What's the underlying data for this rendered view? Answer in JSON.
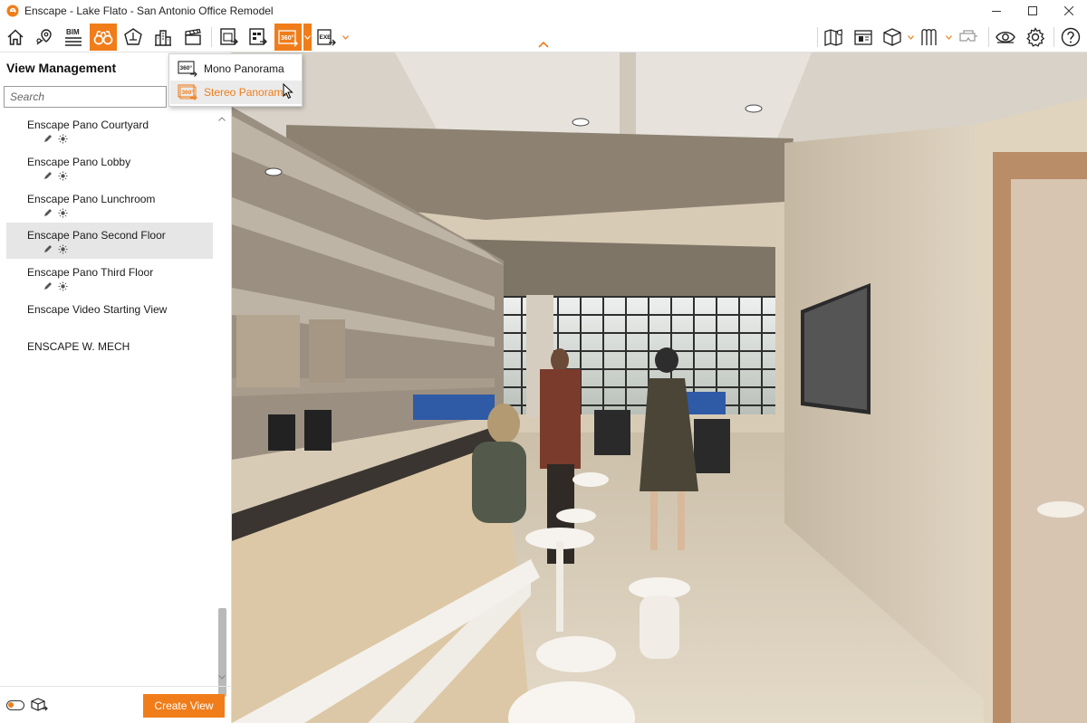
{
  "window": {
    "title": "Enscape - Lake Flato - San Antonio Office Remodel",
    "accent_color": "#f07d1a",
    "controls": [
      "minimize-icon",
      "maximize-icon",
      "close-icon"
    ]
  },
  "toolbar": {
    "left_buttons": [
      "home-icon",
      "location-pin-icon",
      "bim-icon",
      "binoculars-icon",
      "atmosphere-icon",
      "asset-library-icon",
      "video-editor-icon",
      "screenshot-icon",
      "batch-render-icon",
      "panorama-icon",
      "export-icon"
    ],
    "active_buttons": [
      "binoculars-icon",
      "panorama-icon"
    ],
    "bim_label": "BIM",
    "pano_label": "360°",
    "export_label": "EXE",
    "right_buttons": [
      "map-icon",
      "clipboard-icon",
      "cube-icon",
      "material-icon",
      "vr-headset-icon",
      "eye-icon",
      "settings-icon",
      "help-icon"
    ]
  },
  "panorama_menu": {
    "items": [
      {
        "label": "Mono Panorama",
        "icon": "mono-panorama-icon",
        "badge": "360°"
      },
      {
        "label": "Stereo Panorama",
        "icon": "stereo-panorama-icon",
        "badge": "360°"
      }
    ],
    "hovered_index": 1
  },
  "view_management": {
    "title": "View Management",
    "search_placeholder": "Search",
    "views": [
      {
        "label": "Enscape Pano Courtyard",
        "has_icons": true
      },
      {
        "label": "Enscape Pano Lobby",
        "has_icons": true
      },
      {
        "label": "Enscape Pano Lunchroom",
        "has_icons": true
      },
      {
        "label": "Enscape Pano Second Floor",
        "has_icons": true,
        "selected": true
      },
      {
        "label": "Enscape Pano Third Floor",
        "has_icons": true
      },
      {
        "label": "Enscape Video Starting View",
        "has_icons": false
      },
      {
        "label": "ENSCAPE W. MECH",
        "has_icons": false
      }
    ],
    "create_button_label": "Create View"
  }
}
